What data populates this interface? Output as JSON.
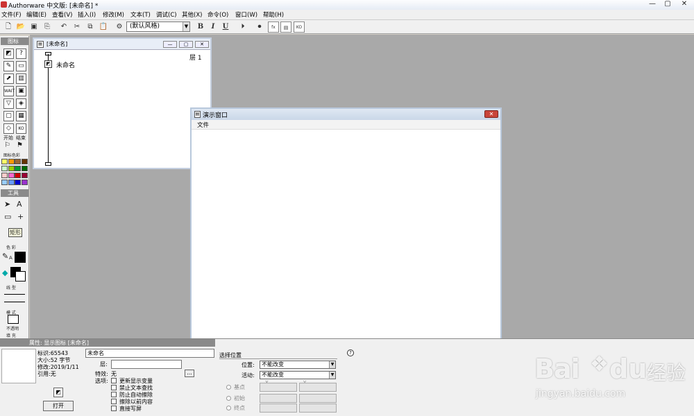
{
  "window": {
    "title": "Authorware 中文版: [未命名] *",
    "min": "—",
    "max": "▢",
    "close": "✕"
  },
  "menu": [
    "文件(F)",
    "编辑(E)",
    "查看(V)",
    "插入(I)",
    "修改(M)",
    "文本(T)",
    "调试(C)",
    "其他(X)",
    "命令(O)",
    "窗口(W)",
    "帮助(H)"
  ],
  "toolbar": {
    "style_value": "(默认风格)",
    "bold": "B",
    "italic": "I",
    "underline": "U"
  },
  "palette": {
    "icons_header": "图标",
    "start_label": "开始",
    "end_label": "结束",
    "icon_color_label": "图标色彩",
    "swatches": [
      "#ffff66",
      "#ff9900",
      "#996633",
      "#663300",
      "#ccffcc",
      "#99cc00",
      "#009933",
      "#006600",
      "#ffcccc",
      "#ff66cc",
      "#cc0000",
      "#990033",
      "#99ccff",
      "#6699ff",
      "#0000cc",
      "#9933cc"
    ],
    "tools_header": "工具",
    "tooltip": "矩形",
    "color_label": "色 彩",
    "line_label": "线 型",
    "mode_label": "模 式",
    "mode_value": "不透明",
    "fill_label": "填 充",
    "fill_value": "无",
    "text_tool": "A"
  },
  "design_window": {
    "title": "[未命名]",
    "level": "层 1",
    "item_name": "未命名"
  },
  "presentation_window": {
    "title": "演示窗口",
    "menu_file": "文件"
  },
  "properties": {
    "header": "属性: 显示图标 [未命名]",
    "id": "标识:65543",
    "size": "大小:52 字节",
    "modified": "修改:2019/1/11",
    "reference": "引用:无",
    "open_button": "打开",
    "name_value": "未命名",
    "layer_label": "层:",
    "effect_label": "特效:",
    "effect_value": "无",
    "ellipsis": "...",
    "options_label": "选项:",
    "options": [
      "更新显示变量",
      "禁止文本查找",
      "防止自动擦除",
      "擦除以前内容",
      "直接写屏"
    ],
    "position_group": "选择位置",
    "position_label": "位置:",
    "position_value": "不能改变",
    "move_label": "活动:",
    "move_value": "不能改变",
    "base_label": "基点",
    "init_label": "初始",
    "end_label": "终点",
    "x_label": "X",
    "y_label": "Y",
    "help": "?"
  },
  "watermark": {
    "brand": "Bai",
    "brand2": "du",
    "cn": "经验",
    "url": "jingyan.baidu.com"
  }
}
